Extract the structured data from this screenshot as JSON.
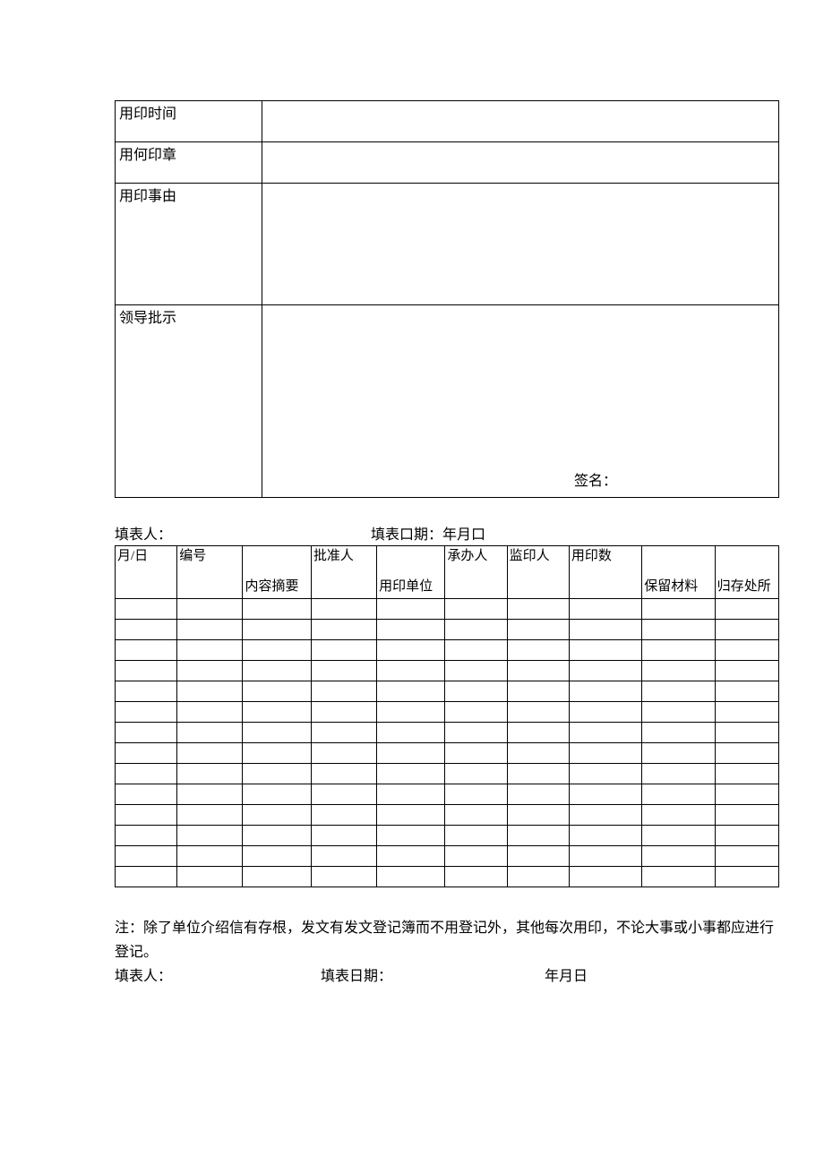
{
  "form": {
    "row1_label": "用印时间",
    "row1_value": "",
    "row2_label": "用何印章",
    "row2_value": "",
    "row3_label": "用印事由",
    "row3_value": "",
    "row4_label": "领导批示",
    "row4_value": "",
    "signature_label": "签名："
  },
  "mid": {
    "filler_label": "填表人：",
    "date_label": "填表口期：年月口"
  },
  "log": {
    "headers": {
      "c1": "月/日",
      "c2": "编号",
      "c3": "内容摘要",
      "c4": "批准人",
      "c5": "用印单位",
      "c6": "承办人",
      "c7": "监印人",
      "c8": "用印数",
      "c9": "保留材料",
      "c10": "归存处所"
    },
    "rows": [
      [
        "",
        "",
        "",
        "",
        "",
        "",
        "",
        "",
        "",
        ""
      ],
      [
        "",
        "",
        "",
        "",
        "",
        "",
        "",
        "",
        "",
        ""
      ],
      [
        "",
        "",
        "",
        "",
        "",
        "",
        "",
        "",
        "",
        ""
      ],
      [
        "",
        "",
        "",
        "",
        "",
        "",
        "",
        "",
        "",
        ""
      ],
      [
        "",
        "",
        "",
        "",
        "",
        "",
        "",
        "",
        "",
        ""
      ],
      [
        "",
        "",
        "",
        "",
        "",
        "",
        "",
        "",
        "",
        ""
      ],
      [
        "",
        "",
        "",
        "",
        "",
        "",
        "",
        "",
        "",
        ""
      ],
      [
        "",
        "",
        "",
        "",
        "",
        "",
        "",
        "",
        "",
        ""
      ],
      [
        "",
        "",
        "",
        "",
        "",
        "",
        "",
        "",
        "",
        ""
      ],
      [
        "",
        "",
        "",
        "",
        "",
        "",
        "",
        "",
        "",
        ""
      ],
      [
        "",
        "",
        "",
        "",
        "",
        "",
        "",
        "",
        "",
        ""
      ],
      [
        "",
        "",
        "",
        "",
        "",
        "",
        "",
        "",
        "",
        ""
      ],
      [
        "",
        "",
        "",
        "",
        "",
        "",
        "",
        "",
        "",
        ""
      ],
      [
        "",
        "",
        "",
        "",
        "",
        "",
        "",
        "",
        "",
        ""
      ]
    ]
  },
  "footer": {
    "note": "注：除了单位介绍信有存根，发文有发文登记簿而不用登记外，其他每次用印，不论大事或小事都应进行登记。",
    "line2_a": "填表人：",
    "line2_b": "填表日期：",
    "line2_c": "年月日"
  }
}
